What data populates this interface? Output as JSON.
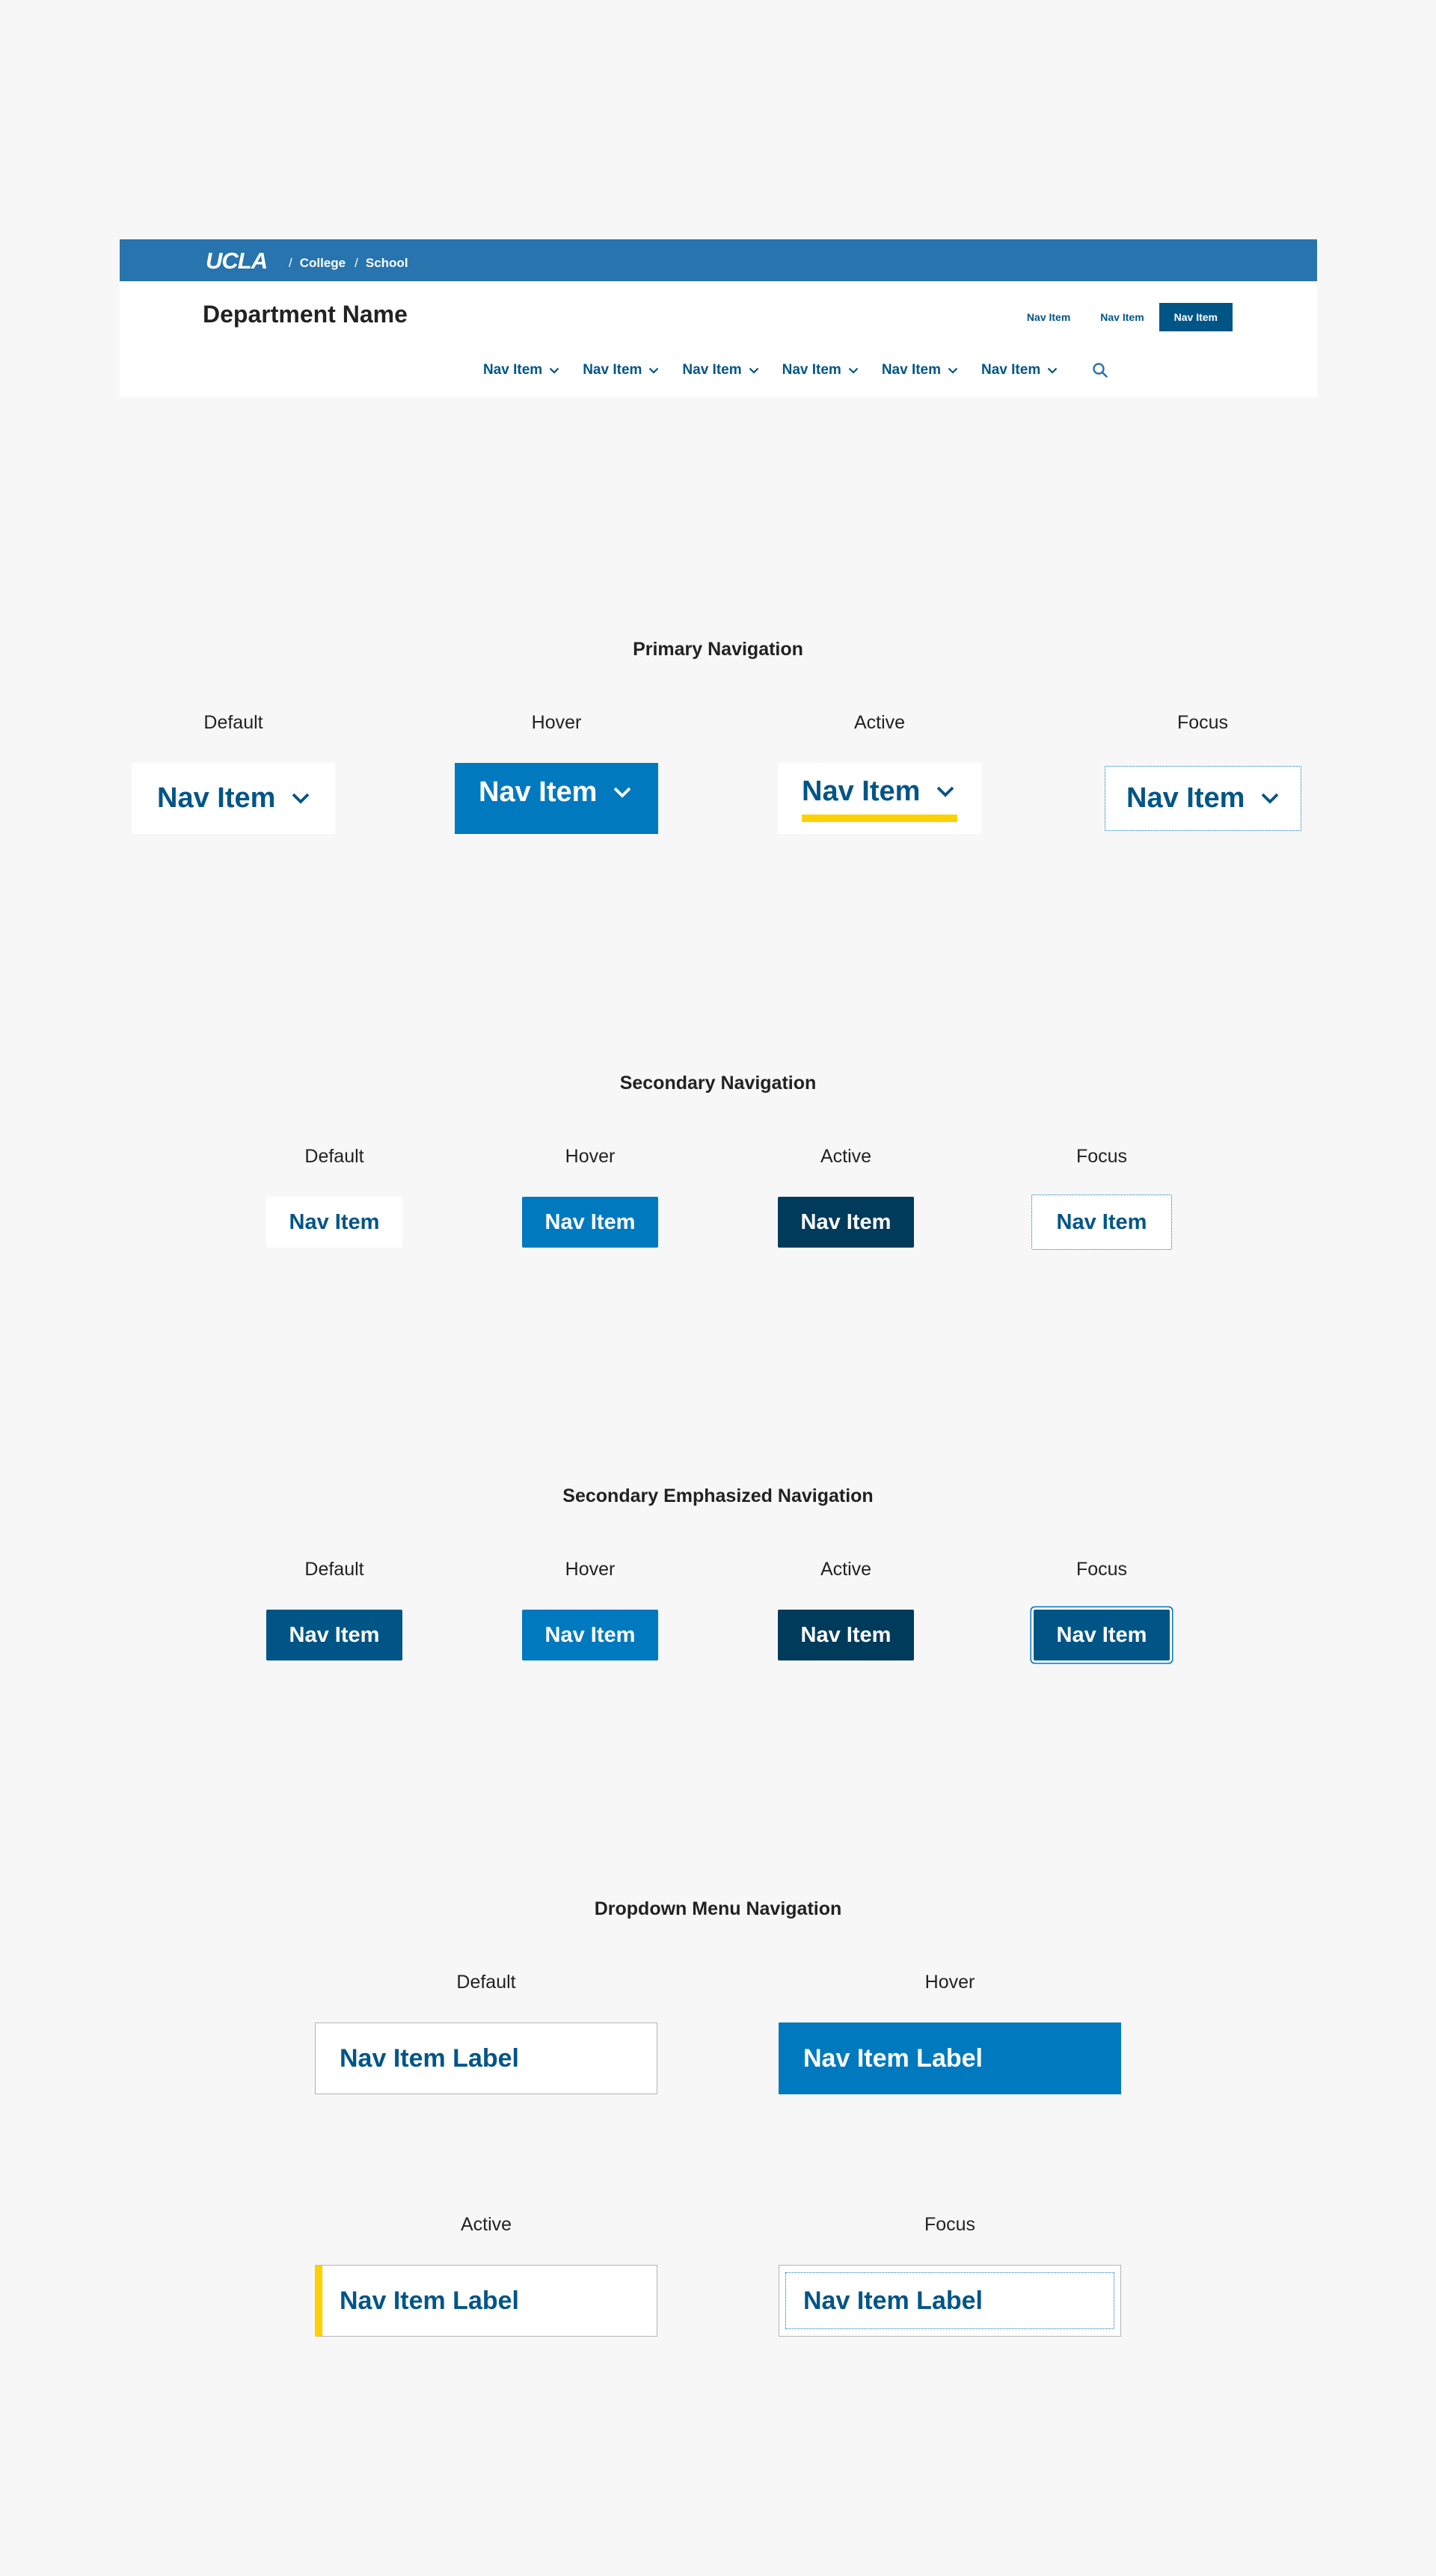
{
  "header": {
    "logo": "UCLA",
    "breadcrumb": {
      "sep": "/",
      "college": "College",
      "school": "School"
    },
    "department": "Department Name",
    "utility_nav": [
      "Nav Item",
      "Nav Item",
      "Nav Item"
    ],
    "main_nav": [
      "Nav Item",
      "Nav Item",
      "Nav Item",
      "Nav Item",
      "Nav Item",
      "Nav Item"
    ]
  },
  "primary": {
    "title": "Primary Navigation",
    "states": {
      "default": "Default",
      "hover": "Hover",
      "active": "Active",
      "focus": "Focus"
    },
    "item": "Nav Item"
  },
  "secondary": {
    "title": "Secondary Navigation",
    "states": {
      "default": "Default",
      "hover": "Hover",
      "active": "Active",
      "focus": "Focus"
    },
    "item": "Nav Item"
  },
  "secondary_emph": {
    "title": "Secondary Emphasized Navigation",
    "states": {
      "default": "Default",
      "hover": "Hover",
      "active": "Active",
      "focus": "Focus"
    },
    "item": "Nav Item"
  },
  "dropdown": {
    "title": "Dropdown Menu Navigation",
    "states": {
      "default": "Default",
      "hover": "Hover",
      "active": "Active",
      "focus": "Focus"
    },
    "item": "Nav Item Label"
  },
  "colors": {
    "brand_blue": "#2774ae",
    "darker_blue": "#005587",
    "lighter_blue": "#0079bf",
    "darkest_blue": "#003b5c",
    "gold": "#ffd100",
    "background": "#f7f7f7"
  },
  "icons": {
    "chevron": "chevron-down-icon",
    "search": "search-icon"
  }
}
